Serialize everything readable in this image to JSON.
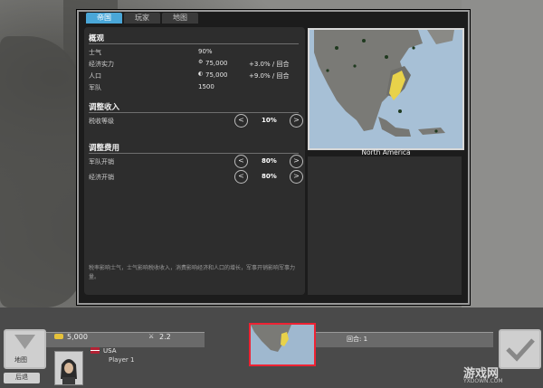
{
  "tabs": [
    {
      "label": "帝国",
      "active": true
    },
    {
      "label": "玩家",
      "active": false
    },
    {
      "label": "地图",
      "active": false
    }
  ],
  "overview": {
    "title": "概观",
    "rows": [
      {
        "label": "士气",
        "value": "90%",
        "delta": ""
      },
      {
        "label": "经济实力",
        "value": "75,000",
        "delta": "+3.0% / 回合"
      },
      {
        "label": "人口",
        "value": "75,000",
        "delta": "+9.0% / 回合"
      },
      {
        "label": "军队",
        "value": "1500",
        "delta": ""
      }
    ]
  },
  "income": {
    "title": "调整收入",
    "rows": [
      {
        "label": "税收等级",
        "value": "10%"
      }
    ]
  },
  "expense": {
    "title": "调整费用",
    "rows": [
      {
        "label": "军队开销",
        "value": "80%"
      },
      {
        "label": "经济开销",
        "value": "80%"
      }
    ]
  },
  "note": "税率影响士气，士气影响税收收入，消费影响经济和人口的增长，军事开销影响军事力量。",
  "map": {
    "caption": "North America"
  },
  "buttons": {
    "minus": "<",
    "plus": ">"
  },
  "hud": {
    "gold": "5,000",
    "strength": "2.2",
    "country": "USA",
    "player": "Player 1",
    "map_button": "地图",
    "back_button": "后退",
    "turn": "回合: 1"
  },
  "watermark": {
    "text": "游戏网",
    "url": "YXDOWN.COM"
  },
  "colors": {
    "tab_active": "#4aa7d8",
    "highlight": "#e8d24a",
    "land": "#6f6f6f"
  }
}
